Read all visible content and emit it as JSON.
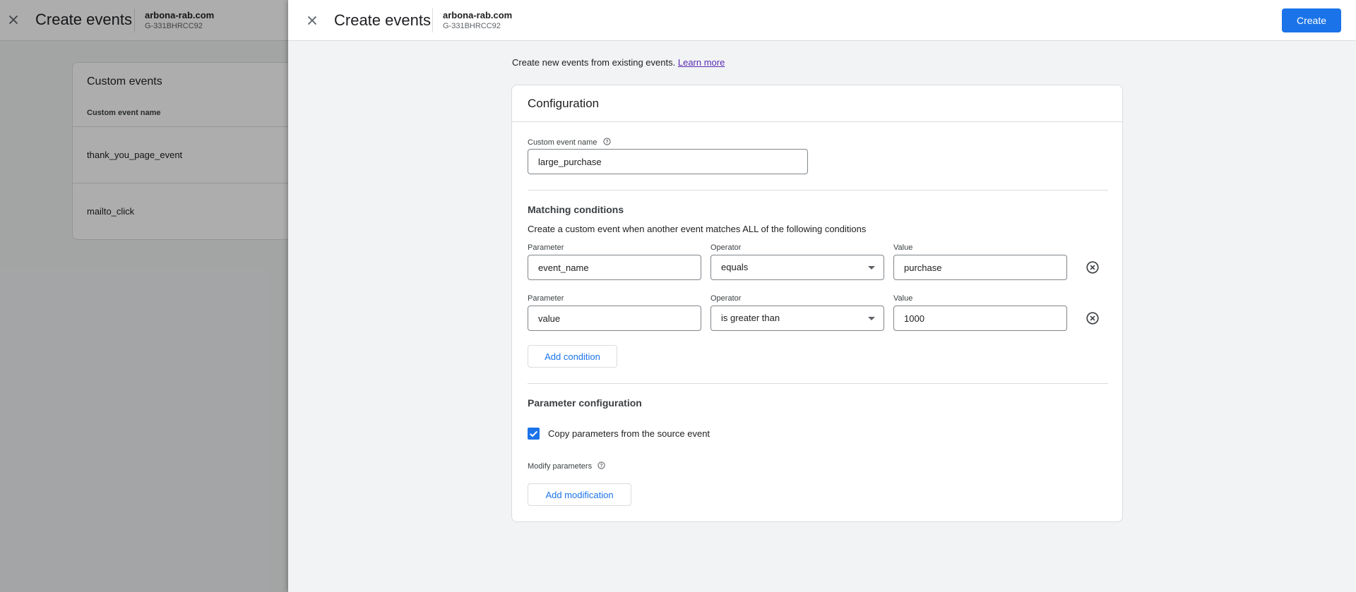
{
  "background": {
    "title": "Create events",
    "property_name": "arbona-rab.com",
    "property_id": "G-331BHRCC92",
    "card_title": "Custom events",
    "column_header": "Custom event name",
    "rows": [
      "thank_you_page_event",
      "mailto_click"
    ]
  },
  "panel": {
    "title": "Create events",
    "property_name": "arbona-rab.com",
    "property_id": "G-331BHRCC92",
    "create_label": "Create",
    "intro_text": "Create new events from existing events.",
    "learn_more": "Learn more"
  },
  "config": {
    "title": "Configuration",
    "custom_event_name_label": "Custom event name",
    "custom_event_name_value": "large_purchase",
    "matching_title": "Matching conditions",
    "matching_desc": "Create a custom event when another event matches ALL of the following conditions",
    "param_label": "Parameter",
    "operator_label": "Operator",
    "value_label": "Value",
    "conditions": [
      {
        "parameter": "event_name",
        "operator": "equals",
        "value": "purchase"
      },
      {
        "parameter": "value",
        "operator": "is greater than",
        "value": "1000"
      }
    ],
    "add_condition": "Add condition",
    "param_config_title": "Parameter configuration",
    "copy_params_label": "Copy parameters from the source event",
    "copy_params_checked": true,
    "modify_label": "Modify parameters",
    "add_modification": "Add modification"
  },
  "colors": {
    "accent": "#1a73e8",
    "link": "#5b2bb5"
  }
}
